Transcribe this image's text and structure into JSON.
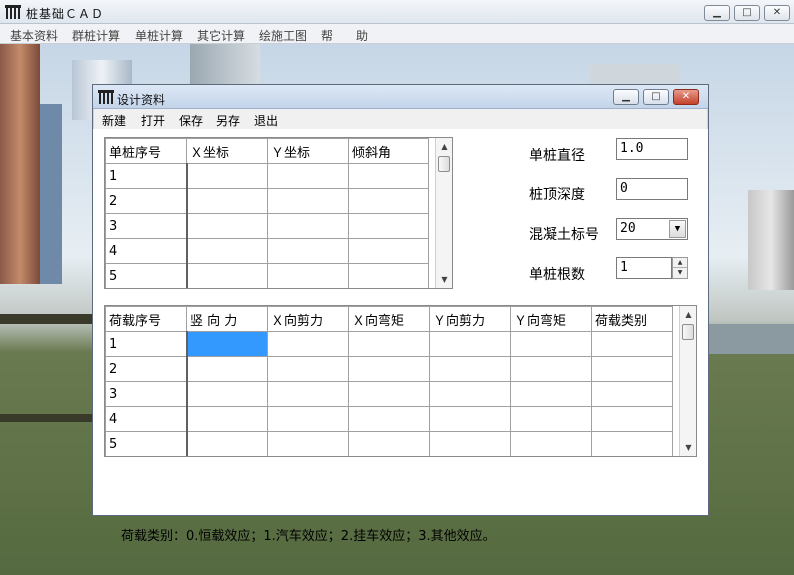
{
  "app": {
    "title": "桩基础ＣＡＤ",
    "menu": [
      "基本资料",
      "群桩计算",
      "单桩计算",
      "其它计算",
      "绘施工图",
      "帮",
      "助"
    ]
  },
  "dialog": {
    "title": "设计资料",
    "menu": [
      "新建",
      "打开",
      "保存",
      "另存",
      "退出"
    ],
    "pile_table": {
      "headers": [
        "单桩序号",
        "Ｘ坐标",
        "Ｙ坐标",
        "倾斜角"
      ],
      "rows": [
        "1",
        "2",
        "3",
        "4",
        "5"
      ]
    },
    "load_table": {
      "headers": [
        "荷载序号",
        "竖 向 力",
        "Ｘ向剪力",
        "Ｘ向弯矩",
        "Ｙ向剪力",
        "Ｙ向弯矩",
        "荷载类别"
      ],
      "rows": [
        "1",
        "2",
        "3",
        "4",
        "5"
      ]
    },
    "fields": {
      "diameter_label": "单桩直径",
      "diameter_value": "1.0",
      "depth_label": "桩顶深度",
      "depth_value": "0",
      "concrete_label": "混凝土标号",
      "concrete_value": "20",
      "count_label": "单桩根数",
      "count_value": "1"
    },
    "note": "荷载类别：0.恒载效应；1.汽车效应；2.挂车效应；3.其他效应。"
  },
  "colors": {
    "selection": "#3399ff",
    "close_button": "#c4412b"
  },
  "icons": [
    "app-icon",
    "minimize-icon",
    "maximize-icon",
    "close-icon",
    "scroll-up-icon",
    "scroll-down-icon",
    "dropdown-arrow-icon"
  ]
}
